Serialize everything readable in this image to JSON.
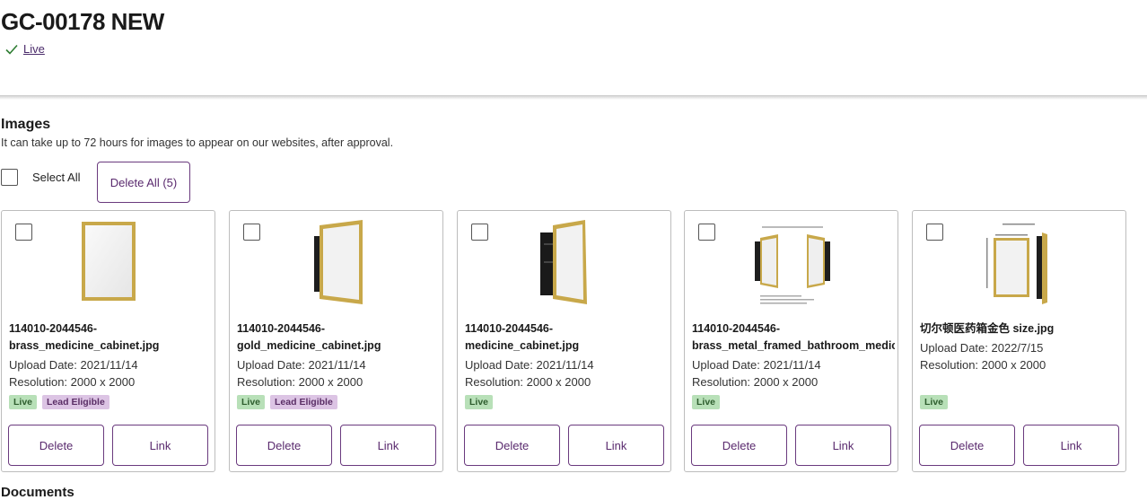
{
  "header": {
    "title": "GC-00178 NEW",
    "status_label": "Live"
  },
  "images_section": {
    "title": "Images",
    "description": "It can take up to 72 hours for images to appear on our websites, after approval.",
    "select_all_label": "Select All",
    "delete_all_label": "Delete All (5)"
  },
  "cards": [
    {
      "name_line1": "114010-2044546-",
      "name_line2": "brass_medicine_cabinet.jpg",
      "upload_date": "Upload Date: 2021/11/14",
      "resolution": "Resolution: 2000 x 2000",
      "badges": [
        "Live",
        "Lead Eligible"
      ],
      "delete_label": "Delete",
      "link_label": "Link"
    },
    {
      "name_line1": "114010-2044546-",
      "name_line2": "gold_medicine_cabinet.jpg",
      "upload_date": "Upload Date: 2021/11/14",
      "resolution": "Resolution: 2000 x 2000",
      "badges": [
        "Live",
        "Lead Eligible"
      ],
      "delete_label": "Delete",
      "link_label": "Link"
    },
    {
      "name_line1": "114010-2044546-",
      "name_line2": "medicine_cabinet.jpg",
      "upload_date": "Upload Date: 2021/11/14",
      "resolution": "Resolution: 2000 x 2000",
      "badges": [
        "Live"
      ],
      "delete_label": "Delete",
      "link_label": "Link"
    },
    {
      "name_line1": "114010-2044546-",
      "name_line2": "brass_metal_framed_bathroom_medic",
      "upload_date": "Upload Date: 2021/11/14",
      "resolution": "Resolution: 2000 x 2000",
      "badges": [
        "Live"
      ],
      "delete_label": "Delete",
      "link_label": "Link"
    },
    {
      "name_line1": "切尔顿医药箱金色 size.jpg",
      "name_line2": "",
      "upload_date": "Upload Date: 2022/7/15",
      "resolution": "Resolution: 2000 x 2000",
      "badges": [
        "Live"
      ],
      "delete_label": "Delete",
      "link_label": "Link"
    }
  ],
  "documents_section": {
    "title": "Documents"
  },
  "colors": {
    "accent": "#5a2a6e",
    "live_badge": "#b8e0b8",
    "lead_badge": "#dcc4e4",
    "frame_gold": "#c8a84a"
  },
  "icons": {
    "status": "check-icon",
    "thumbnails": [
      "medicine-cabinet-front-icon",
      "medicine-cabinet-open-icon",
      "medicine-cabinet-open-icon",
      "medicine-cabinet-diagram-icon",
      "medicine-cabinet-dimensions-icon"
    ]
  }
}
